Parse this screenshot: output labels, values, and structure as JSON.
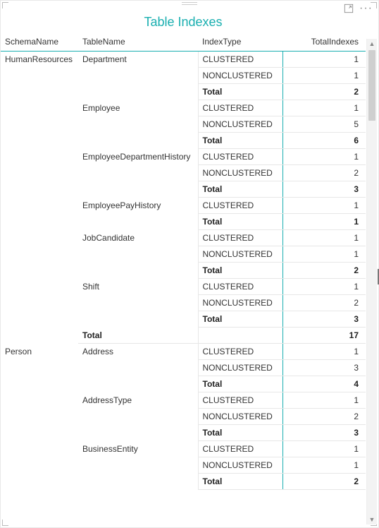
{
  "title": "Table Indexes",
  "columns": {
    "schema": "SchemaName",
    "table": "TableName",
    "type": "IndexType",
    "total": "TotalIndexes"
  },
  "totalLabel": "Total",
  "schemas": [
    {
      "name": "HumanResources",
      "total": 17,
      "tables": [
        {
          "name": "Department",
          "rows": [
            {
              "type": "CLUSTERED",
              "count": 1
            },
            {
              "type": "NONCLUSTERED",
              "count": 1
            }
          ],
          "total": 2
        },
        {
          "name": "Employee",
          "rows": [
            {
              "type": "CLUSTERED",
              "count": 1
            },
            {
              "type": "NONCLUSTERED",
              "count": 5
            }
          ],
          "total": 6
        },
        {
          "name": "EmployeeDepartmentHistory",
          "rows": [
            {
              "type": "CLUSTERED",
              "count": 1
            },
            {
              "type": "NONCLUSTERED",
              "count": 2
            }
          ],
          "total": 3
        },
        {
          "name": "EmployeePayHistory",
          "rows": [
            {
              "type": "CLUSTERED",
              "count": 1
            }
          ],
          "total": 1
        },
        {
          "name": "JobCandidate",
          "rows": [
            {
              "type": "CLUSTERED",
              "count": 1
            },
            {
              "type": "NONCLUSTERED",
              "count": 1
            }
          ],
          "total": 2
        },
        {
          "name": "Shift",
          "rows": [
            {
              "type": "CLUSTERED",
              "count": 1
            },
            {
              "type": "NONCLUSTERED",
              "count": 2
            }
          ],
          "total": 3
        }
      ]
    },
    {
      "name": "Person",
      "total": null,
      "tables": [
        {
          "name": "Address",
          "rows": [
            {
              "type": "CLUSTERED",
              "count": 1
            },
            {
              "type": "NONCLUSTERED",
              "count": 3
            }
          ],
          "total": 4
        },
        {
          "name": "AddressType",
          "rows": [
            {
              "type": "CLUSTERED",
              "count": 1
            },
            {
              "type": "NONCLUSTERED",
              "count": 2
            }
          ],
          "total": 3
        },
        {
          "name": "BusinessEntity",
          "rows": [
            {
              "type": "CLUSTERED",
              "count": 1
            },
            {
              "type": "NONCLUSTERED",
              "count": 1
            }
          ],
          "total": 2
        }
      ]
    }
  ]
}
